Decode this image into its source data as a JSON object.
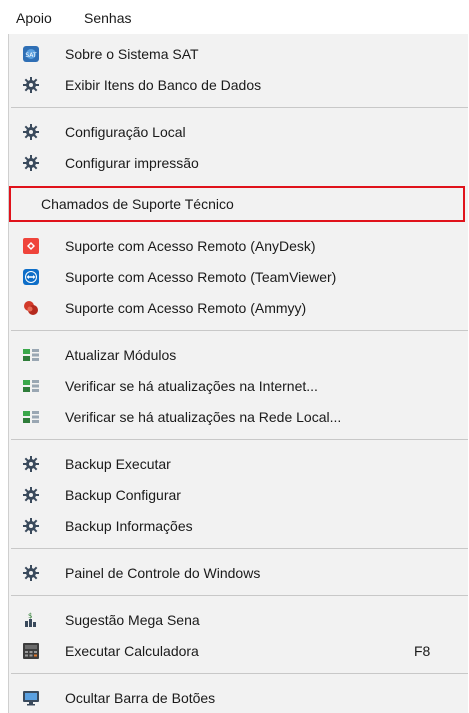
{
  "menubar": {
    "items": [
      "Apoio",
      "Senhas"
    ]
  },
  "menu": {
    "items": [
      {
        "label": "Sobre o Sistema SAT",
        "icon": "sat-logo-icon"
      },
      {
        "label": "Exibir Itens do Banco de Dados",
        "icon": "gear-icon"
      },
      {
        "label": "Configuração Local",
        "icon": "gear-icon"
      },
      {
        "label": "Configurar impressão",
        "icon": "gear-icon"
      },
      {
        "label": "Chamados de Suporte Técnico",
        "icon": ""
      },
      {
        "label": "Suporte com Acesso Remoto (AnyDesk)",
        "icon": "anydesk-icon"
      },
      {
        "label": "Suporte com Acesso Remoto (TeamViewer)",
        "icon": "teamviewer-icon"
      },
      {
        "label": "Suporte com Acesso Remoto (Ammyy)",
        "icon": "ammyy-icon"
      },
      {
        "label": "Atualizar Módulos",
        "icon": "update-modules-icon"
      },
      {
        "label": "Verificar se há atualizações na Internet...",
        "icon": "update-modules-icon"
      },
      {
        "label": "Verificar se há atualizações na Rede Local...",
        "icon": "update-modules-icon"
      },
      {
        "label": "Backup Executar",
        "icon": "gear-icon"
      },
      {
        "label": "Backup Configurar",
        "icon": "gear-icon"
      },
      {
        "label": "Backup Informações",
        "icon": "gear-icon"
      },
      {
        "label": "Painel de Controle do Windows",
        "icon": "gear-icon"
      },
      {
        "label": "Sugestão Mega Sena",
        "icon": "dollar-chart-icon"
      },
      {
        "label": "Executar Calculadora",
        "icon": "calculator-icon",
        "shortcut": "F8"
      },
      {
        "label": "Ocultar Barra de Botões",
        "icon": "monitor-icon"
      }
    ]
  },
  "colors": {
    "menu_bg": "#f2f2f2",
    "highlight_border": "#e0121b",
    "separator": "#c8c8c8",
    "gear": "#3a4a5c"
  }
}
